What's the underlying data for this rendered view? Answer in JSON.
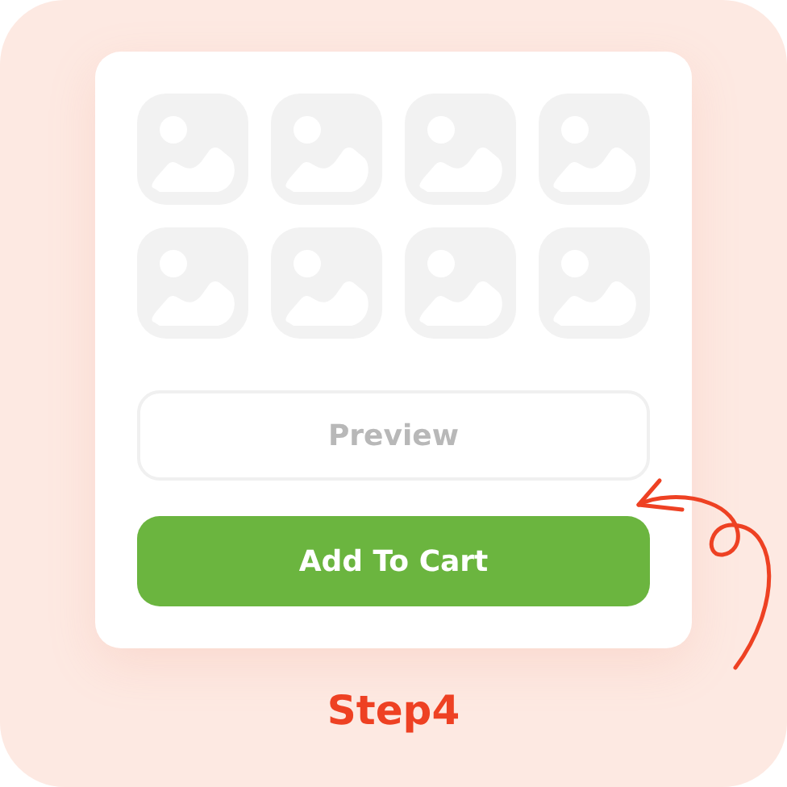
{
  "preview_button": {
    "label": "Preview",
    "disabled": true
  },
  "add_to_cart_button": {
    "label": "Add To Cart"
  },
  "step_label": "Step4"
}
